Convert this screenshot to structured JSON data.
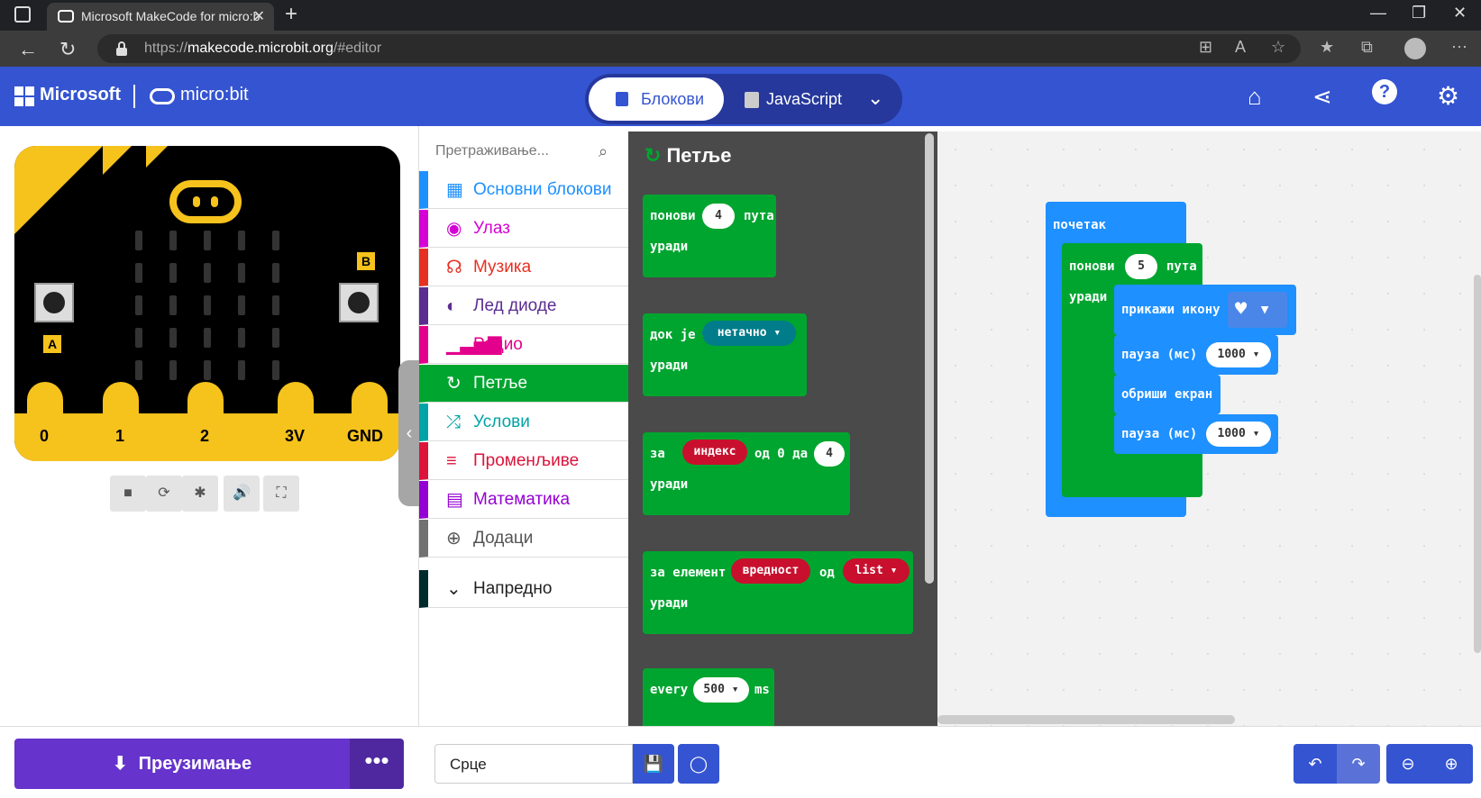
{
  "browser": {
    "tab_title": "Microsoft MakeCode for micro:b",
    "url_prefix": "https://",
    "url_host": "makecode.microbit.org",
    "url_path": "/#editor"
  },
  "header": {
    "brand_microsoft": "Microsoft",
    "brand_microbit": "micro:bit",
    "blocks_label": "Блокови",
    "javascript_label": "JavaScript"
  },
  "simulator": {
    "button_a": "A",
    "button_b": "B",
    "pins": [
      "0",
      "1",
      "2",
      "3V",
      "GND"
    ]
  },
  "toolbox": {
    "search_placeholder": "Претраживање...",
    "categories": [
      {
        "label": "Основни блокови",
        "color": "#1e90ff"
      },
      {
        "label": "Улаз",
        "color": "#d400d4"
      },
      {
        "label": "Музика",
        "color": "#e63022"
      },
      {
        "label": "Лед диоде",
        "color": "#5c2d91"
      },
      {
        "label": "Радио",
        "color": "#e3008c"
      },
      {
        "label": "Петље",
        "color": "#00a52f"
      },
      {
        "label": "Услови",
        "color": "#00a4a6"
      },
      {
        "label": "Променљиве",
        "color": "#dc143c"
      },
      {
        "label": "Математика",
        "color": "#9400d3"
      },
      {
        "label": "Додаци",
        "color": "#717171"
      }
    ],
    "advanced_label": "Напредно"
  },
  "flyout": {
    "title": "Петље",
    "repeat": {
      "label": "понови",
      "count": "4",
      "suffix": "пута",
      "do": "уради"
    },
    "while": {
      "label": "док је",
      "condition": "нетачно",
      "do": "уради"
    },
    "for": {
      "label": "за",
      "var": "индекс",
      "from": "од 0 да",
      "to": "4",
      "do": "уради"
    },
    "foreach": {
      "label": "за елемент",
      "var": "вредност",
      "of": "од",
      "list": "list",
      "do": "уради"
    },
    "every": {
      "label": "every",
      "value": "500",
      "unit": "ms"
    }
  },
  "workspace": {
    "start_label": "почетак",
    "repeat_label": "понови",
    "repeat_count": "5",
    "repeat_suffix": "пута",
    "repeat_do": "уради",
    "show_icon_label": "прикажи икону",
    "pause1_label": "пауза (мс)",
    "pause1_value": "1000",
    "clear_label": "обриши екран",
    "pause2_label": "пауза (мс)",
    "pause2_value": "1000"
  },
  "bottom": {
    "download_label": "Преузимање",
    "more_label": "•••",
    "project_name": "Срце"
  }
}
